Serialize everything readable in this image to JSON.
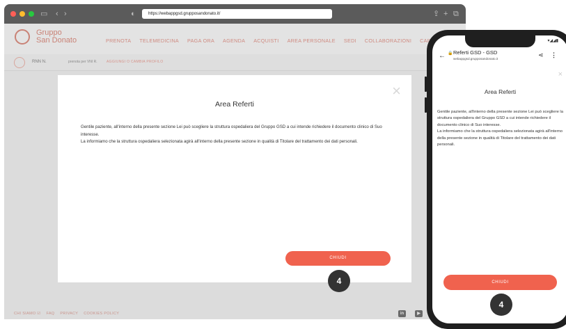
{
  "browser": {
    "url": "https://webappgsd.grupposandonato.it/"
  },
  "site": {
    "logo_line1": "Gruppo",
    "logo_line2": "San Donato",
    "nav": [
      "PRENOTA",
      "TELEMEDICINA",
      "PAGA ORA",
      "AGENDA",
      "ACQUISTI",
      "AREA PERSONALE",
      "SEDI",
      "COLLABORAZIONI",
      "CARRELLO"
    ],
    "rnn": "RNN N.",
    "prenota_per": "prenota per VNI R.",
    "change_profile": "AGGIUNGI O CAMBIA PROFILO",
    "footer_links": [
      "CHI SIAMO ☑",
      "FAQ",
      "PRIVACY",
      "COOKIES POLICY"
    ],
    "social": [
      "in",
      "▶"
    ]
  },
  "modal": {
    "close": "×",
    "title": "Area Referti",
    "paragraph1": "Gentile paziente, all'interno della presente sezione Lei può scegliere la struttura ospedaliera del Gruppo GSD a cui intende richiedere il documento clinico di Suo interesse.",
    "paragraph2": "La informiamo che la struttura ospedaliera selezionata agirà all'interno della presente sezione in qualità di Titolare del trattamento dei dati personali.",
    "button": "CHIUDI"
  },
  "badge_desktop": "4",
  "phone": {
    "status": "▾◢◢▮",
    "tab_title": "Referti GSD - GSD",
    "tab_url": "webappgsd.grupposandonato.it",
    "back": "←",
    "lock": "🔒",
    "share": "⋖",
    "menu": "⋮",
    "close": "×",
    "title": "Area Referti",
    "paragraph1": "Gentile paziente, all'interno della presente sezione Lei può scegliere la struttura ospedaliera del Gruppo GSD a cui intende richiedere il documento clinico di Suo interesse.",
    "paragraph2": "La informiamo che la struttura ospedaliera selezionata agirà all'interno della presente sezione in qualità di Titolare del trattamento dei dati personali.",
    "button": "CHIUDI"
  },
  "badge_phone": "4",
  "colors": {
    "accent": "#f0624e",
    "brand": "#c98276",
    "badge": "#333333"
  }
}
